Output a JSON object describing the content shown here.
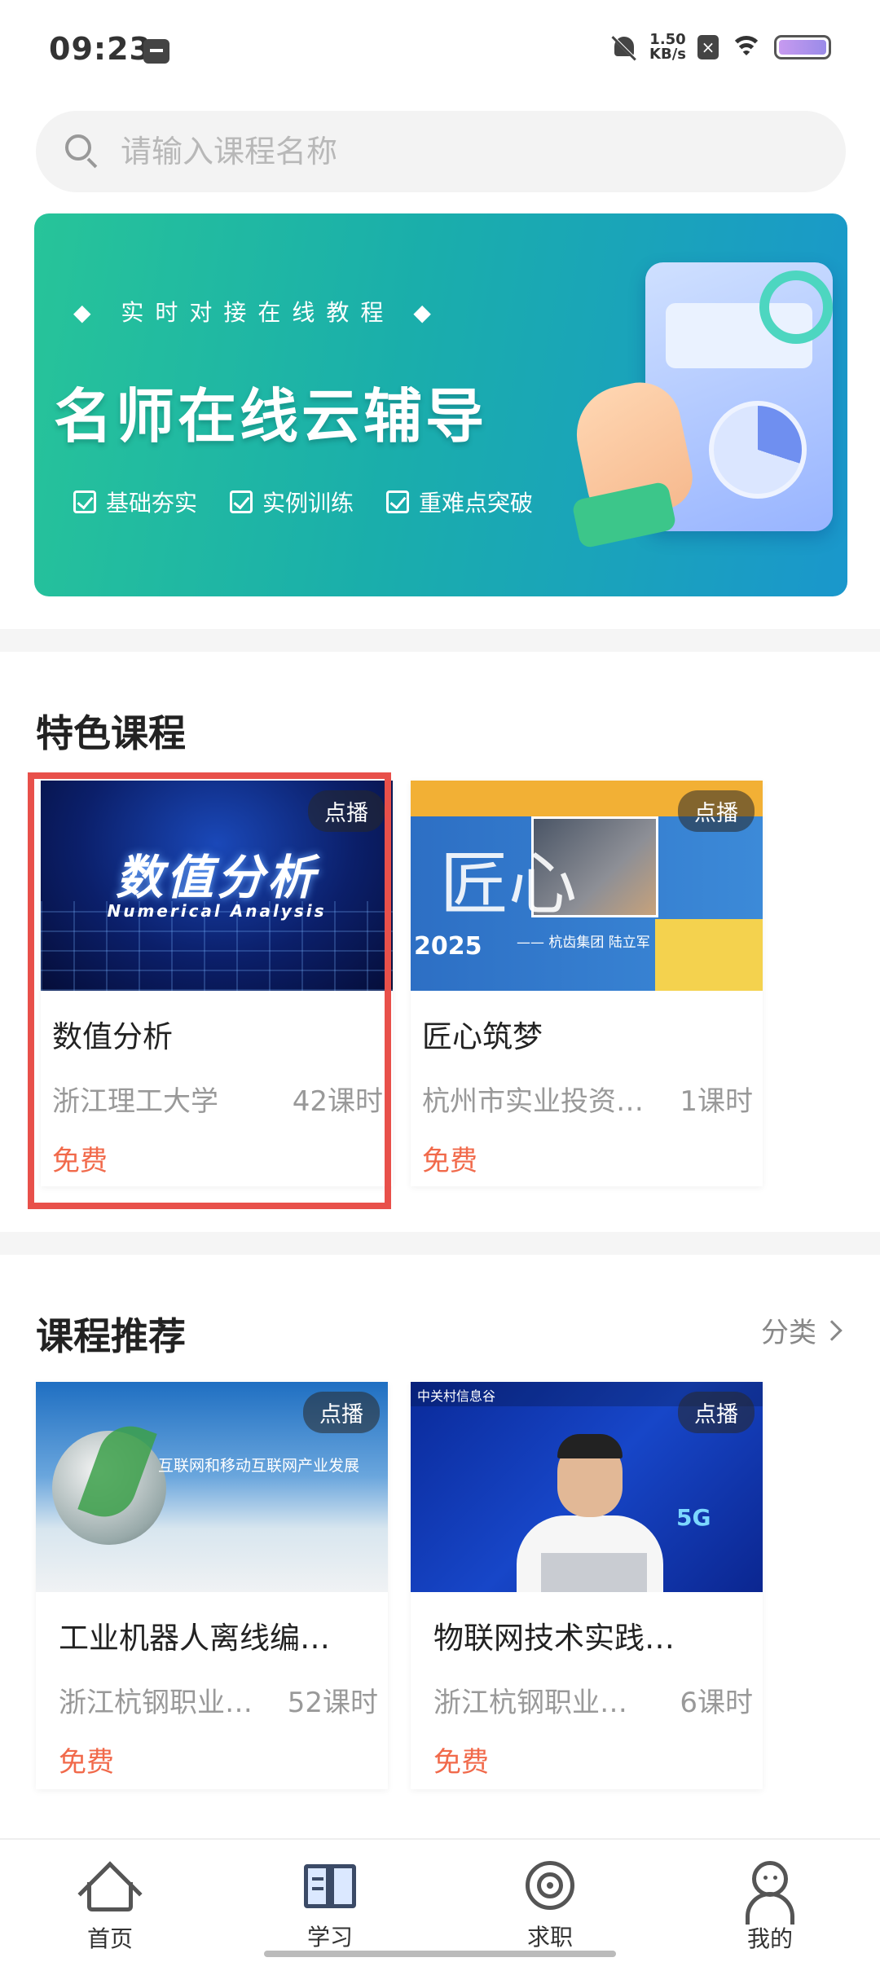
{
  "status_bar": {
    "time": "09:23",
    "net_speed_value": "1.50",
    "net_speed_unit": "KB/s",
    "icons": [
      "sim-icon",
      "mute-icon",
      "close-box-icon",
      "wifi-icon",
      "battery-icon"
    ]
  },
  "search": {
    "placeholder": "请输入课程名称"
  },
  "banner": {
    "subtitle": "◆ 实时对接在线教程 ◆",
    "title": "名师在线云辅导",
    "tags": [
      "基础夯实",
      "实例训练",
      "重难点突破"
    ]
  },
  "featured": {
    "section_title": "特色课程",
    "courses": [
      {
        "badge": "点播",
        "thumb_title": "数值分析",
        "thumb_subtitle": "Numerical Analysis",
        "title": "数值分析",
        "provider": "浙江理工大学",
        "hours": "42课时",
        "price": "免费"
      },
      {
        "badge": "点播",
        "thumb_title": "匠心",
        "thumb_year": "2025",
        "thumb_byline": "—— 杭齿集团 陆立军",
        "title": "匠心筑梦",
        "provider": "杭州市实业投资…",
        "hours": "1课时",
        "price": "免费"
      }
    ]
  },
  "recommend": {
    "section_title": "课程推荐",
    "category_link": "分类",
    "courses": [
      {
        "badge": "点播",
        "thumb_caption": "互联网和移动互联网产业发展",
        "title": "工业机器人离线编…",
        "provider": "浙江杭钢职业…",
        "hours": "52课时",
        "price": "免费"
      },
      {
        "badge": "点播",
        "thumb_header": "中关村信息谷",
        "thumb_tag": "5G",
        "title": "物联网技术实践…",
        "provider": "浙江杭钢职业…",
        "hours": "6课时",
        "price": "免费"
      }
    ]
  },
  "bottom_nav": {
    "items": [
      {
        "label": "首页",
        "icon": "home-icon"
      },
      {
        "label": "学习",
        "icon": "book-icon",
        "active": true
      },
      {
        "label": "求职",
        "icon": "target-icon"
      },
      {
        "label": "我的",
        "icon": "user-icon"
      }
    ]
  },
  "colors": {
    "price": "#f16a4b",
    "highlight": "#e8504a",
    "banner_start": "#27c499",
    "banner_end": "#1a97cc"
  }
}
